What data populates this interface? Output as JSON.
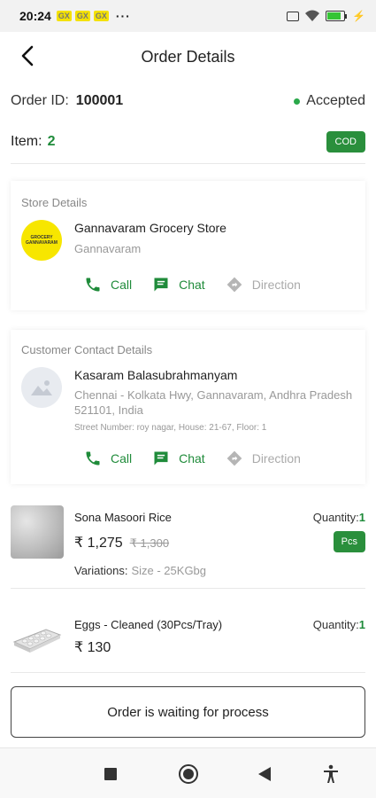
{
  "status_bar": {
    "time": "20:24",
    "indicators": [
      "GX",
      "GX",
      "GX"
    ],
    "more": "···",
    "battery_level": 0.85
  },
  "header": {
    "title": "Order Details",
    "back_icon": "back-arrow-icon"
  },
  "order": {
    "id_label": "Order ID:",
    "id": "100001",
    "status": "Accepted",
    "status_color": "#2aa84a",
    "item_label": "Item:",
    "item_count": "2",
    "payment_badge": "COD"
  },
  "store": {
    "section_title": "Store Details",
    "logo_text_top": "GROCERY",
    "logo_text_bottom": "GANNAVARAM",
    "name": "Gannavaram Grocery Store",
    "location": "Gannavaram",
    "actions": {
      "call": "Call",
      "chat": "Chat",
      "direction": "Direction"
    }
  },
  "customer": {
    "section_title": "Customer Contact Details",
    "name": "Kasaram Balasubrahmanyam",
    "address": "Chennai - Kolkata Hwy, Gannavaram, Andhra Pradesh 521101, India",
    "street": "Street Number: roy nagar, House: 21-67, Floor: 1",
    "actions": {
      "call": "Call",
      "chat": "Chat",
      "direction": "Direction"
    }
  },
  "products": [
    {
      "name": "Sona Masoori Rice",
      "price": "₹ 1,275",
      "old_price": "₹ 1,300",
      "qty_label": "Quantity:",
      "qty": "1",
      "unit": "Pcs",
      "variation_label": "Variations:",
      "variation_value": "Size - 25KGbg"
    },
    {
      "name": "Eggs - Cleaned (30Pcs/Tray)",
      "price": "₹ 130",
      "qty_label": "Quantity:",
      "qty": "1"
    }
  ],
  "footer": {
    "process_button": "Order is waiting for process"
  },
  "colors": {
    "accent_green": "#1f8b3a",
    "badge_green": "#2a8f3c",
    "logo_yellow": "#f7e600"
  }
}
